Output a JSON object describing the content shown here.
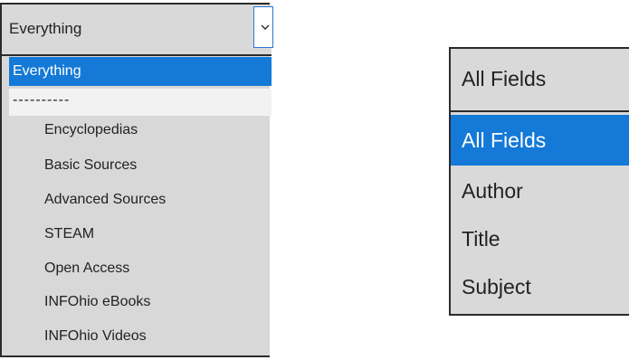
{
  "left_dropdown": {
    "selected_value": "Everything",
    "options": [
      "Everything",
      "----------",
      "Encyclopedias",
      "Basic Sources",
      "Advanced Sources",
      "STEAM",
      "Open Access",
      "INFOhio eBooks",
      "INFOhio Videos"
    ],
    "highlighted_index": 0
  },
  "right_dropdown": {
    "selected_value": "All Fields",
    "options": [
      "All Fields",
      "Author",
      "Title",
      "Subject"
    ],
    "highlighted_index": 0
  },
  "colors": {
    "highlight": "#1479d7",
    "dropdown_bg": "#d9d9d9",
    "border": "#2b2b2b",
    "separator_bg": "#f2f2f2"
  },
  "icons": {
    "left_toggle": "chevron-down-icon"
  }
}
